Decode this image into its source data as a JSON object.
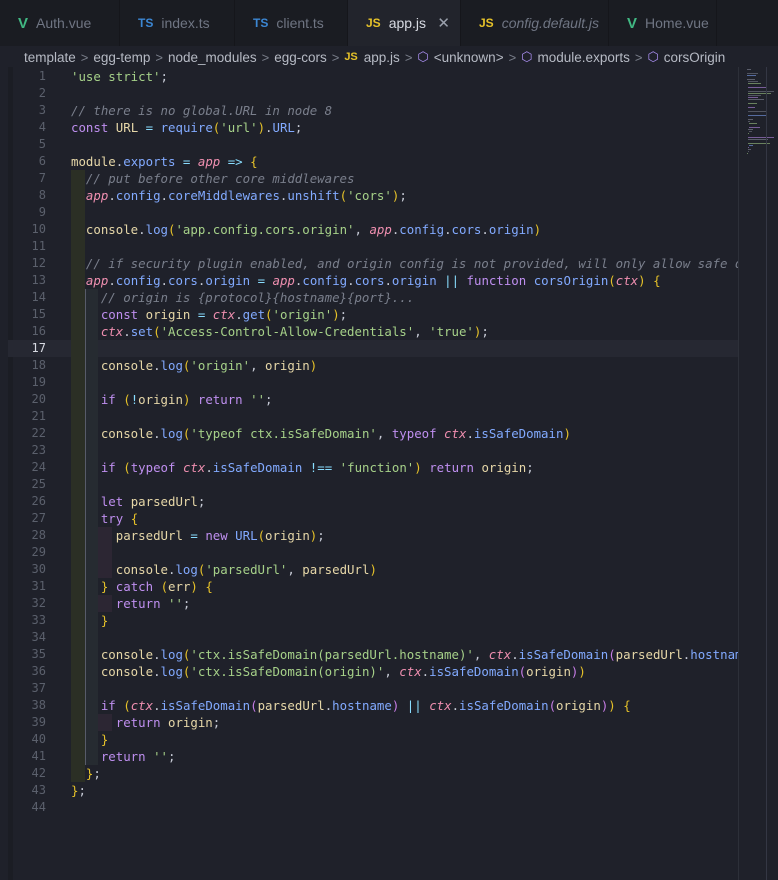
{
  "tabs": [
    {
      "label": "Auth.vue",
      "icon": "vue",
      "icon_glyph": "V",
      "active": false,
      "italic": false
    },
    {
      "label": "index.ts",
      "icon": "ts",
      "icon_glyph": "TS",
      "active": false,
      "italic": false
    },
    {
      "label": "client.ts",
      "icon": "ts",
      "icon_glyph": "TS",
      "active": false,
      "italic": false
    },
    {
      "label": "app.js",
      "icon": "js",
      "icon_glyph": "JS",
      "active": true,
      "italic": false,
      "close_glyph": "✕"
    },
    {
      "label": "config.default.js",
      "icon": "js",
      "icon_glyph": "JS",
      "active": false,
      "italic": true
    },
    {
      "label": "Home.vue",
      "icon": "vue",
      "icon_glyph": "V",
      "active": false,
      "italic": false
    }
  ],
  "breadcrumb": {
    "segments": [
      "template",
      "egg-temp",
      "node_modules",
      "egg-cors"
    ],
    "file_badge": "JS",
    "file": "app.js",
    "symbols": [
      "<unknown>",
      "module.exports",
      "corsOrigin"
    ],
    "separator": ">"
  },
  "editor": {
    "current_line": 17,
    "line_numbers": [
      "1",
      "2",
      "3",
      "4",
      "5",
      "6",
      "7",
      "8",
      "9",
      "10",
      "11",
      "12",
      "13",
      "14",
      "15",
      "16",
      "17",
      "18",
      "19",
      "20",
      "21",
      "22",
      "23",
      "24",
      "25",
      "26",
      "27",
      "28",
      "29",
      "30",
      "31",
      "32",
      "33",
      "34",
      "35",
      "36",
      "37",
      "38",
      "39",
      "40",
      "41",
      "42",
      "43",
      "44"
    ],
    "lines": [
      "'use strict';",
      "",
      "// there is no global.URL in node 8",
      "const URL = require('url').URL;",
      "",
      "module.exports = app => {",
      "  // put before other core middlewares",
      "  app.config.coreMiddlewares.unshift('cors');",
      "",
      "  console.log('app.config.cors.origin', app.config.cors.origin)",
      "",
      "  // if security plugin enabled, and origin config is not provided, will only allow safe domains s",
      "  app.config.cors.origin = app.config.cors.origin || function corsOrigin(ctx) {",
      "    // origin is {protocol}{hostname}{port}...",
      "    const origin = ctx.get('origin');",
      "    ctx.set('Access-Control-Allow-Credentials', 'true');",
      "",
      "    console.log('origin', origin)",
      "",
      "    if (!origin) return '';",
      "",
      "    console.log('typeof ctx.isSafeDomain', typeof ctx.isSafeDomain)",
      "",
      "    if (typeof ctx.isSafeDomain !== 'function') return origin;",
      "",
      "    let parsedUrl;",
      "    try {",
      "      parsedUrl = new URL(origin);",
      "",
      "      console.log('parsedUrl', parsedUrl)",
      "    } catch (err) {",
      "      return '';",
      "    }",
      "",
      "    console.log('ctx.isSafeDomain(parsedUrl.hostname)', ctx.isSafeDomain(parsedUrl.hostname))",
      "    console.log('ctx.isSafeDomain(origin)', ctx.isSafeDomain(origin))",
      "",
      "    if (ctx.isSafeDomain(parsedUrl.hostname) || ctx.isSafeDomain(origin)) {",
      "      return origin;",
      "    }",
      "    return '';",
      "  };",
      "};",
      ""
    ]
  },
  "colors": {
    "background": "#1f212a",
    "tabbar": "#1a1c22",
    "keyword": "#bf8ff0",
    "string": "#a6d189",
    "comment": "#7a7f8c",
    "function": "#82aaff",
    "parameter": "#ef8fb0",
    "vue_icon": "#41b883",
    "ts_icon": "#3c87d4",
    "js_icon": "#e6c229"
  }
}
